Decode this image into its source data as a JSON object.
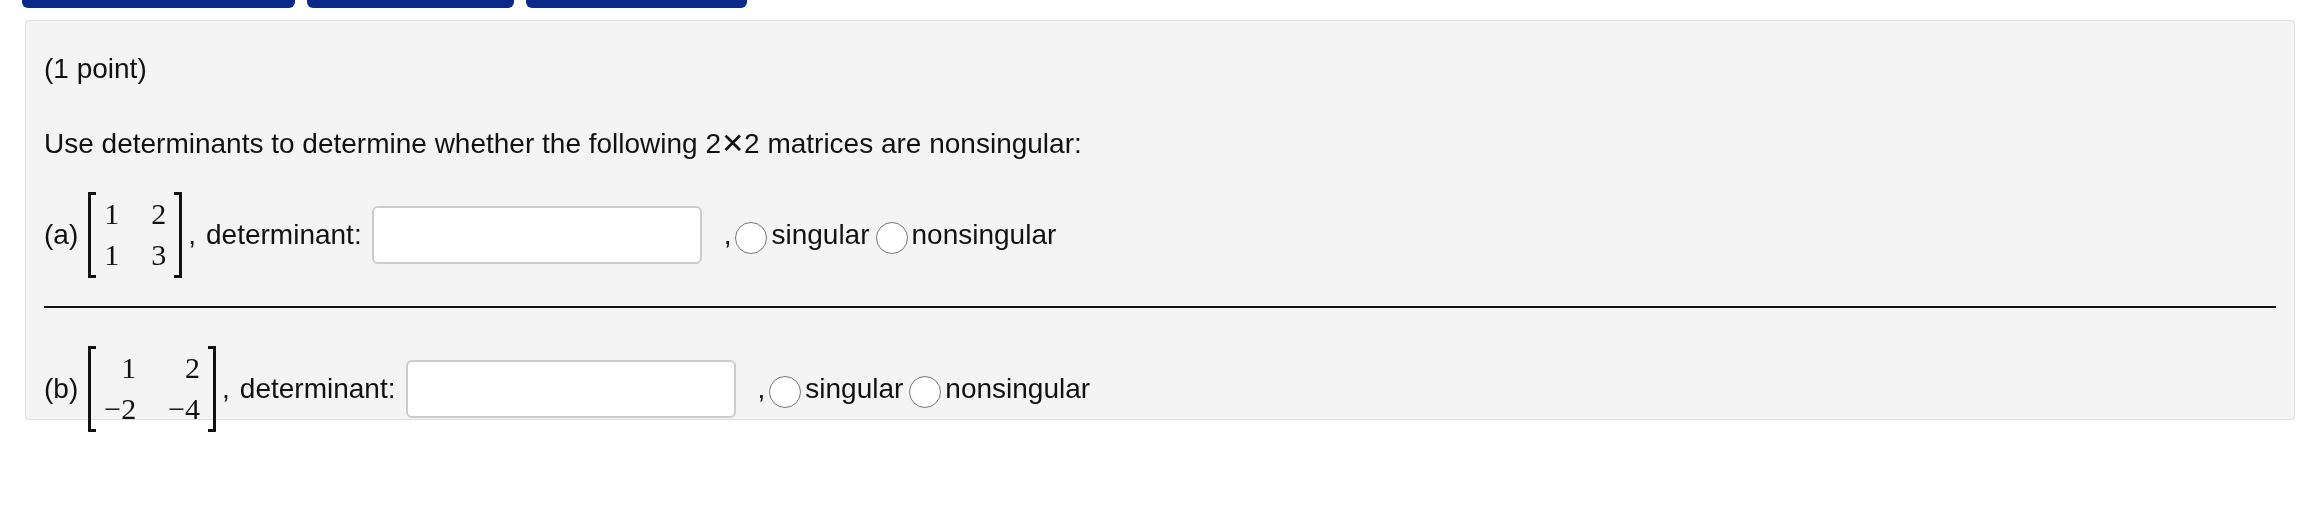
{
  "top_buttons": [
    {
      "kind": "button"
    },
    {
      "kind": "button"
    },
    {
      "kind": "button"
    }
  ],
  "points": "(1 point)",
  "question": "Use determinants to determine whether the following 2✕2 matrices are nonsingular:",
  "parts": [
    {
      "label": "(a)",
      "matrix": [
        [
          "1",
          "2"
        ],
        [
          "1",
          "3"
        ]
      ],
      "comma": ",",
      "determinant_label": "determinant:",
      "comma_2": ",",
      "options": [
        {
          "label": "singular",
          "selected": false
        },
        {
          "label": "nonsingular",
          "selected": false
        }
      ]
    },
    {
      "label": "(b)",
      "matrix": [
        [
          "1",
          "2"
        ],
        [
          "−2",
          "−4"
        ]
      ],
      "comma": ",",
      "determinant_label": "determinant:",
      "comma_2": ",",
      "options": [
        {
          "label": "singular",
          "selected": false
        },
        {
          "label": "nonsingular",
          "selected": false
        }
      ]
    }
  ]
}
